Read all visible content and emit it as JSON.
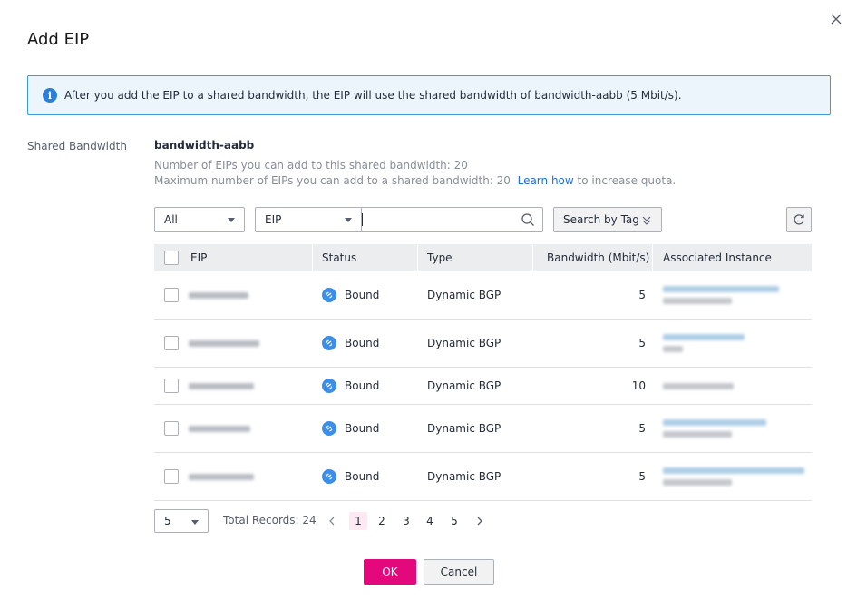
{
  "dialog": {
    "title": "Add EIP"
  },
  "notice": {
    "text": "After you add the EIP to a shared bandwidth, the EIP will use the shared bandwidth of bandwidth-aabb (5 Mbit/s)."
  },
  "shared_bandwidth": {
    "label": "Shared Bandwidth",
    "name": "bandwidth-aabb",
    "line1": "Number of EIPs you can add to this shared bandwidth: 20",
    "line2_prefix": "Maximum number of EIPs you can add to a shared bandwidth: 20",
    "learn_how": "Learn how",
    "line2_suffix": "to increase quota."
  },
  "filters": {
    "scope_value": "All",
    "field_value": "EIP",
    "search_value": "",
    "tag_button": "Search by Tag"
  },
  "table": {
    "columns": [
      "EIP",
      "Status",
      "Type",
      "Bandwidth (Mbit/s)",
      "Associated Instance"
    ],
    "rows": [
      {
        "status": "Bound",
        "type": "Dynamic BGP",
        "bandwidth": "5"
      },
      {
        "status": "Bound",
        "type": "Dynamic BGP",
        "bandwidth": "5"
      },
      {
        "status": "Bound",
        "type": "Dynamic BGP",
        "bandwidth": "10"
      },
      {
        "status": "Bound",
        "type": "Dynamic BGP",
        "bandwidth": "5"
      },
      {
        "status": "Bound",
        "type": "Dynamic BGP",
        "bandwidth": "5"
      }
    ]
  },
  "pagination": {
    "page_size": "5",
    "total_records": "Total Records: 24",
    "pages": [
      "1",
      "2",
      "3",
      "4",
      "5"
    ],
    "current_page": "1"
  },
  "buttons": {
    "ok": "OK",
    "cancel": "Cancel"
  },
  "colors": {
    "primary": "#e3097d",
    "info": "#2c7fd6",
    "link": "#1e6fd9",
    "bound": "#3c8ee6"
  },
  "icons": [
    "close-icon",
    "info-icon",
    "search-icon",
    "chevron-down-icon",
    "refresh-icon",
    "bound-link-icon",
    "chevron-left-icon",
    "chevron-right-icon"
  ]
}
